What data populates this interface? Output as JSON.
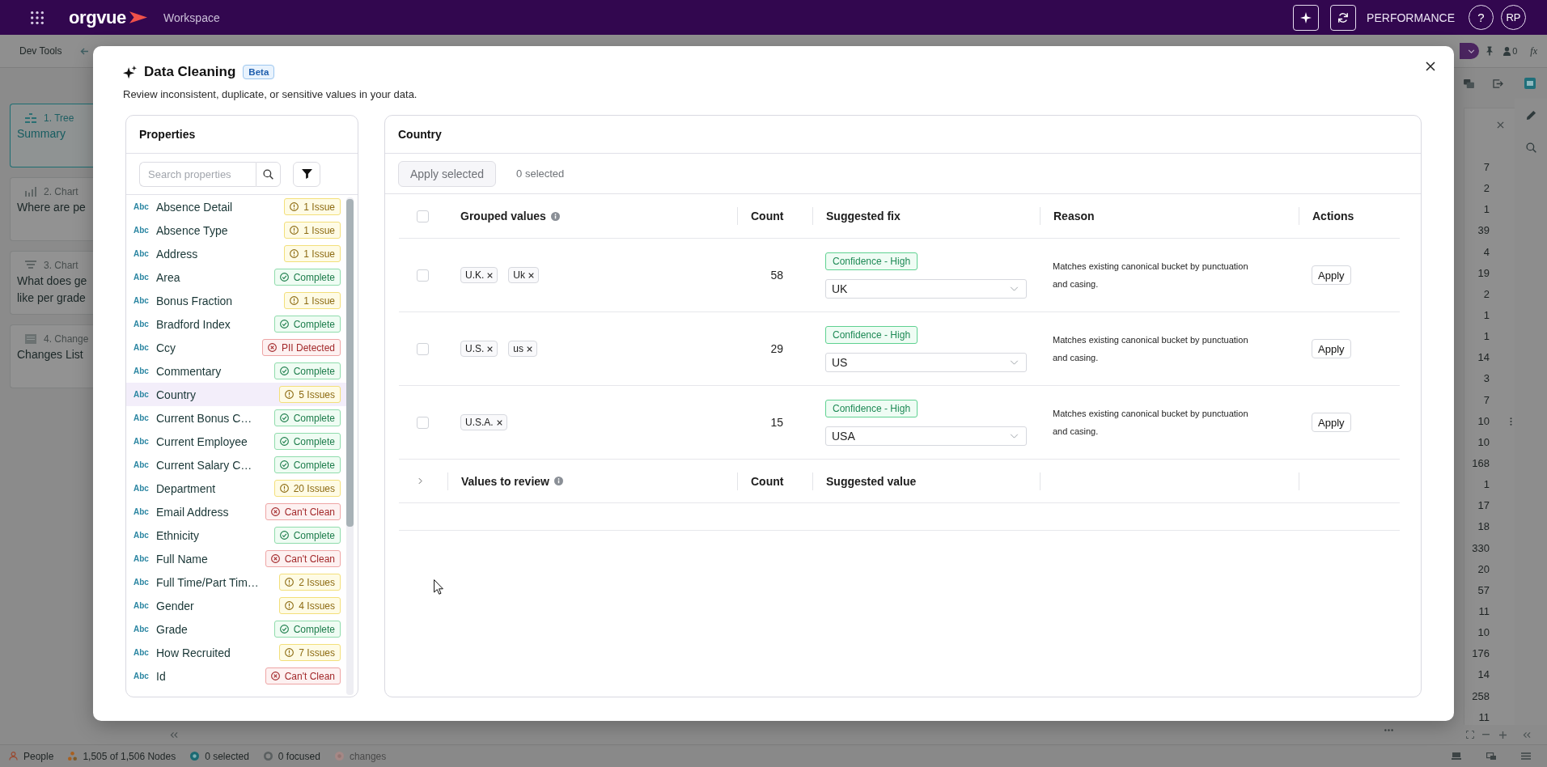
{
  "app_bar": {
    "logo": "orgvue",
    "workspace": "Workspace",
    "mode": "PERFORMANCE",
    "help": "?",
    "avatar": "RP"
  },
  "toolbar": {
    "title": "Dev Tools",
    "user_count": "0",
    "formula": "fx"
  },
  "story_cards": [
    {
      "kind": "tree",
      "number": "1. Tree",
      "lines": [
        "Summary"
      ],
      "selected": true
    },
    {
      "kind": "bar",
      "number": "2. Chart",
      "lines": [
        "Where are pe"
      ],
      "selected": false
    },
    {
      "kind": "funnel",
      "number": "3. Chart",
      "lines": [
        "What does ge",
        "like per grade"
      ],
      "selected": false
    },
    {
      "kind": "changes",
      "number": "4. Change",
      "lines": [
        "Changes List"
      ],
      "selected": false
    }
  ],
  "count_column": {
    "values": [
      "7",
      "2",
      "1",
      "39",
      "4",
      "19",
      "2",
      "1",
      "1",
      "14",
      "3",
      "7",
      "10",
      "10",
      "168",
      "1",
      "17",
      "18",
      "330",
      "20",
      "57",
      "11",
      "10",
      "176",
      "14",
      "258",
      "11"
    ]
  },
  "status_bar": {
    "items": [
      {
        "kind": "people",
        "label": "People",
        "disabled": false
      },
      {
        "kind": "nodes",
        "label": "1,505 of 1,506 Nodes",
        "disabled": false
      },
      {
        "kind": "selected",
        "label": "0 selected",
        "disabled": false
      },
      {
        "kind": "focused",
        "label": "0 focused",
        "disabled": false
      },
      {
        "kind": "changes",
        "label": "changes",
        "disabled": true
      }
    ]
  },
  "dialog": {
    "title": "Data Cleaning",
    "badge": "Beta",
    "subtitle": "Review inconsistent, duplicate, or sensitive values in your data.",
    "properties": {
      "title": "Properties",
      "search": {
        "placeholder": "Search properties"
      },
      "items": [
        {
          "type": "Abc",
          "name": "Absence Detail",
          "status": {
            "kind": "issue",
            "text": "1 Issue"
          },
          "selected": false
        },
        {
          "type": "Abc",
          "name": "Absence Type",
          "status": {
            "kind": "issue",
            "text": "1 Issue"
          },
          "selected": false
        },
        {
          "type": "Abc",
          "name": "Address",
          "status": {
            "kind": "issue",
            "text": "1 Issue"
          },
          "selected": false
        },
        {
          "type": "Abc",
          "name": "Area",
          "status": {
            "kind": "complete",
            "text": "Complete"
          },
          "selected": false
        },
        {
          "type": "Abc",
          "name": "Bonus Fraction",
          "status": {
            "kind": "issue",
            "text": "1 Issue"
          },
          "selected": false
        },
        {
          "type": "Abc",
          "name": "Bradford Index",
          "status": {
            "kind": "complete",
            "text": "Complete"
          },
          "selected": false
        },
        {
          "type": "Abc",
          "name": "Ccy",
          "status": {
            "kind": "error",
            "text": "PII Detected"
          },
          "selected": false
        },
        {
          "type": "Abc",
          "name": "Commentary",
          "status": {
            "kind": "complete",
            "text": "Complete"
          },
          "selected": false
        },
        {
          "type": "Abc",
          "name": "Country",
          "status": {
            "kind": "issue",
            "text": "5 Issues"
          },
          "selected": true
        },
        {
          "type": "Abc",
          "name": "Current Bonus C…",
          "status": {
            "kind": "complete",
            "text": "Complete"
          },
          "selected": false
        },
        {
          "type": "Abc",
          "name": "Current Employee",
          "status": {
            "kind": "complete",
            "text": "Complete"
          },
          "selected": false
        },
        {
          "type": "Abc",
          "name": "Current Salary C…",
          "status": {
            "kind": "complete",
            "text": "Complete"
          },
          "selected": false
        },
        {
          "type": "Abc",
          "name": "Department",
          "status": {
            "kind": "issue",
            "text": "20 Issues"
          },
          "selected": false
        },
        {
          "type": "Abc",
          "name": "Email Address",
          "status": {
            "kind": "error",
            "text": "Can't Clean"
          },
          "selected": false
        },
        {
          "type": "Abc",
          "name": "Ethnicity",
          "status": {
            "kind": "complete",
            "text": "Complete"
          },
          "selected": false
        },
        {
          "type": "Abc",
          "name": "Full Name",
          "status": {
            "kind": "error",
            "text": "Can't Clean"
          },
          "selected": false
        },
        {
          "type": "Abc",
          "name": "Full Time/Part Tim…",
          "status": {
            "kind": "issue",
            "text": "2 Issues"
          },
          "selected": false
        },
        {
          "type": "Abc",
          "name": "Gender",
          "status": {
            "kind": "issue",
            "text": "4 Issues"
          },
          "selected": false
        },
        {
          "type": "Abc",
          "name": "Grade",
          "status": {
            "kind": "complete",
            "text": "Complete"
          },
          "selected": false
        },
        {
          "type": "Abc",
          "name": "How Recruited",
          "status": {
            "kind": "issue",
            "text": "7 Issues"
          },
          "selected": false
        },
        {
          "type": "Abc",
          "name": "Id",
          "status": {
            "kind": "error",
            "text": "Can't Clean"
          },
          "selected": false
        }
      ]
    },
    "detail": {
      "title": "Country",
      "apply_selected": {
        "label": "Apply selected",
        "disabled": true
      },
      "selection_count": "0 selected",
      "select_all": {
        "checked": false
      },
      "columns": [
        {
          "label": "Grouped values",
          "kind": "info"
        },
        {
          "label": "Count",
          "kind": "plain"
        },
        {
          "label": "Suggested fix",
          "kind": "plain"
        },
        {
          "label": "Reason",
          "kind": "plain"
        },
        {
          "label": "Actions",
          "kind": "plain"
        }
      ],
      "rows": [
        {
          "checked": false,
          "values": [
            "U.K.",
            "Uk"
          ],
          "count": "58",
          "confidence": {
            "text": "Confidence - High",
            "kind": "high"
          },
          "fix": "UK",
          "reason": "Matches existing canonical bucket by punctuation and casing.",
          "action": "Apply"
        },
        {
          "checked": false,
          "values": [
            "U.S.",
            "us"
          ],
          "count": "29",
          "confidence": {
            "text": "Confidence - High",
            "kind": "high"
          },
          "fix": "US",
          "reason": "Matches existing canonical bucket by punctuation and casing.",
          "action": "Apply"
        },
        {
          "checked": false,
          "values": [
            "U.S.A."
          ],
          "count": "15",
          "confidence": {
            "text": "Confidence - High",
            "kind": "high"
          },
          "fix": "USA",
          "reason": "Matches existing canonical bucket by punctuation and casing.",
          "action": "Apply"
        }
      ],
      "review": {
        "label": "Values to review",
        "expanded": false,
        "columns": [
          "Count",
          "Suggested value"
        ]
      }
    }
  }
}
